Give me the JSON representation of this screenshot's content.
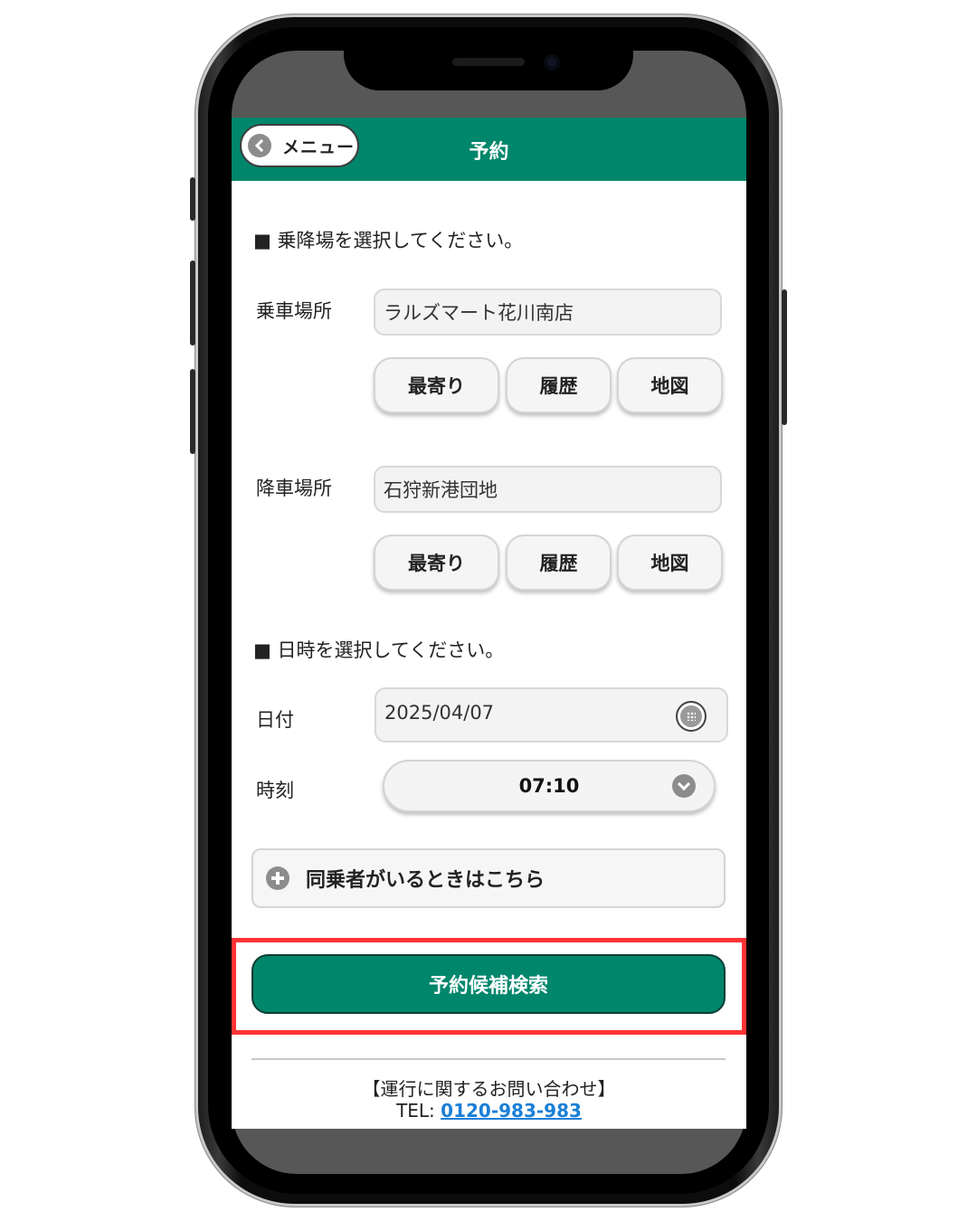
{
  "header": {
    "back_label": "メニュー",
    "title": "予約"
  },
  "stops": {
    "section_title": "■ 乗降場を選択してください。",
    "pickup": {
      "label": "乗車場所",
      "value": "ラルズマート花川南店"
    },
    "dropoff": {
      "label": "降車場所",
      "value": "石狩新港団地"
    },
    "buttons": {
      "nearest": "最寄り",
      "history": "履歴",
      "map": "地図"
    }
  },
  "datetime": {
    "section_title": "■ 日時を選択してください。",
    "date_label": "日付",
    "date_value": "2025/04/07",
    "time_label": "時刻",
    "time_value": "07:10"
  },
  "companion": {
    "label": "同乗者がいるときはこちら"
  },
  "search_button": "予約候補検索",
  "footer": {
    "heading": "【運行に関するお問い合わせ】",
    "tel_prefix": "TEL: ",
    "tel_number": "0120-983-983"
  },
  "colors": {
    "brand_green": "#00866b",
    "highlight_red": "#ff3335",
    "link_blue": "#1a7fd6"
  }
}
